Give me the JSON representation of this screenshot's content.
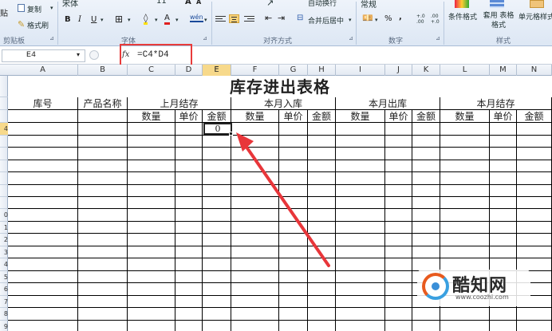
{
  "ribbon": {
    "clipboard": {
      "paste": "贴",
      "copy": "复制",
      "format_painter": "格式刷",
      "label": "剪贴板"
    },
    "font": {
      "name": "宋体",
      "size": "11",
      "bold": "B",
      "italic": "I",
      "underline": "U",
      "grow": "A",
      "shrink": "A",
      "font_color": "A",
      "phonetic": "wén",
      "label": "字体"
    },
    "alignment": {
      "wrap": "自动换行",
      "merge": "合并后居中",
      "label": "对齐方式"
    },
    "number": {
      "format": "常规",
      "percent": "%",
      "comma": ",",
      "inc_decimal": "+.0 .00",
      "dec_decimal": ".00 +.0",
      "label": "数字"
    },
    "styles": {
      "conditional": "条件格式",
      "table": "套用 表格格式",
      "cell": "单元格样式",
      "label": "样式"
    }
  },
  "formula_bar": {
    "name_box": "E4",
    "fx": "fx",
    "formula": "=C4*D4"
  },
  "columns": [
    "A",
    "B",
    "C",
    "D",
    "E",
    "F",
    "G",
    "H",
    "I",
    "J",
    "K",
    "L",
    "M",
    "N"
  ],
  "selected_column": "E",
  "rows": [
    "",
    "",
    "",
    "4",
    "",
    "",
    "",
    "",
    "",
    "",
    "0",
    "1",
    "2",
    "3",
    "4",
    "5",
    "6",
    "7",
    "8",
    "9"
  ],
  "sheet": {
    "title": "库存进出表格",
    "header1": {
      "code": "库号",
      "product": "产品名称",
      "prev": "上月结存",
      "in": "本月入库",
      "out": "本月出库",
      "end": "本月结存"
    },
    "header2": [
      "数量",
      "单价",
      "金额",
      "数量",
      "单价",
      "金额",
      "数量",
      "单价",
      "金额",
      "数量",
      "单价",
      "金额"
    ],
    "active_value": "0"
  },
  "watermark": {
    "name": "酷知网",
    "url": "www.coozhi.com"
  },
  "colors": {
    "accent_red": "#e83b3b",
    "selection": "#f7d98b"
  }
}
